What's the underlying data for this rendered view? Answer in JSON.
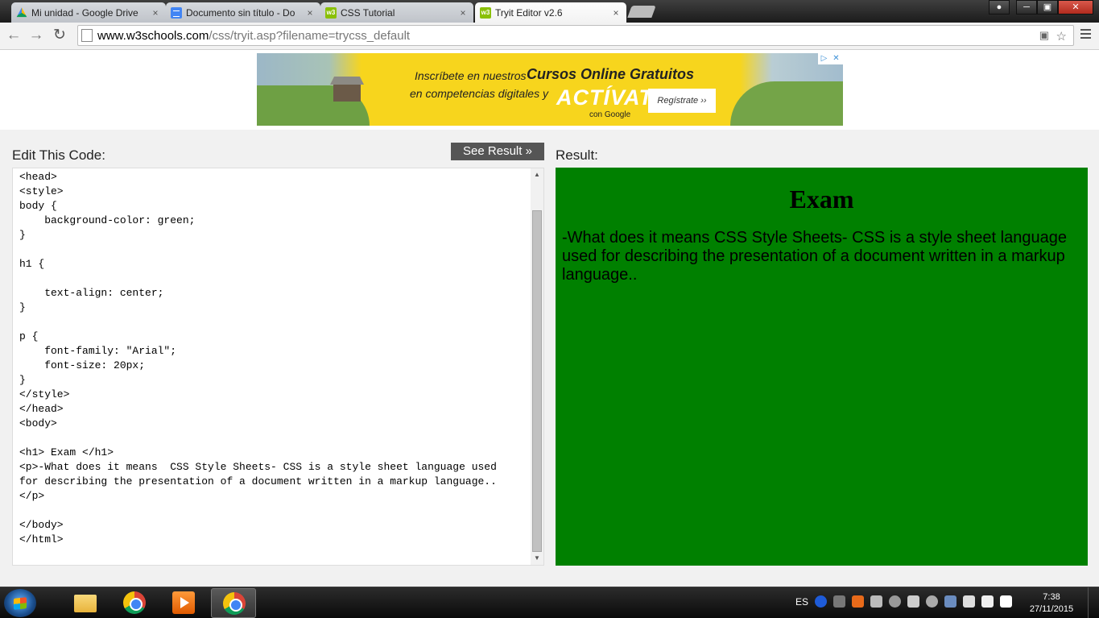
{
  "browser": {
    "tabs": [
      {
        "title": "Mi unidad - Google Drive",
        "icon": "google-drive-icon"
      },
      {
        "title": "Documento sin título - Do",
        "icon": "google-docs-icon"
      },
      {
        "title": "CSS Tutorial",
        "icon": "w3schools-icon"
      },
      {
        "title": "Tryit Editor v2.6",
        "icon": "w3schools-icon",
        "active": true
      }
    ],
    "tab_close_label": "×",
    "url_host": "www.w3schools.com",
    "url_path": "/css/tryit.asp?filename=trycss_default"
  },
  "ad": {
    "line1": "Inscríbete en nuestros",
    "line1_bold": "Cursos Online Gratuitos",
    "line2": "en competencias digitales y",
    "cta": "ACTÍVATE",
    "brand": "con Google",
    "button": "Regístrate ››",
    "choices_icon": "▷",
    "close_icon": "✕"
  },
  "editor": {
    "label": "Edit This Code:",
    "see_result": "See Result »",
    "code": "<head>\n<style>\nbody {\n    background-color: green;\n}\n\nh1 {\n\n    text-align: center;\n}\n\np {\n    font-family: \"Arial\";\n    font-size: 20px;\n}\n</style>\n</head>\n<body>\n\n<h1> Exam </h1>\n<p>-What does it means  CSS Style Sheets- CSS is a style sheet language used\nfor describing the presentation of a document written in a markup language..\n</p>\n\n</body>\n</html>"
  },
  "result": {
    "label": "Result:",
    "heading": "Exam",
    "paragraph": "-What does it means CSS Style Sheets- CSS is a style sheet language used for describing the presentation of a document written in a markup language..",
    "background": "#008000"
  },
  "taskbar": {
    "language": "ES",
    "time": "7:38",
    "date": "27/11/2015"
  }
}
